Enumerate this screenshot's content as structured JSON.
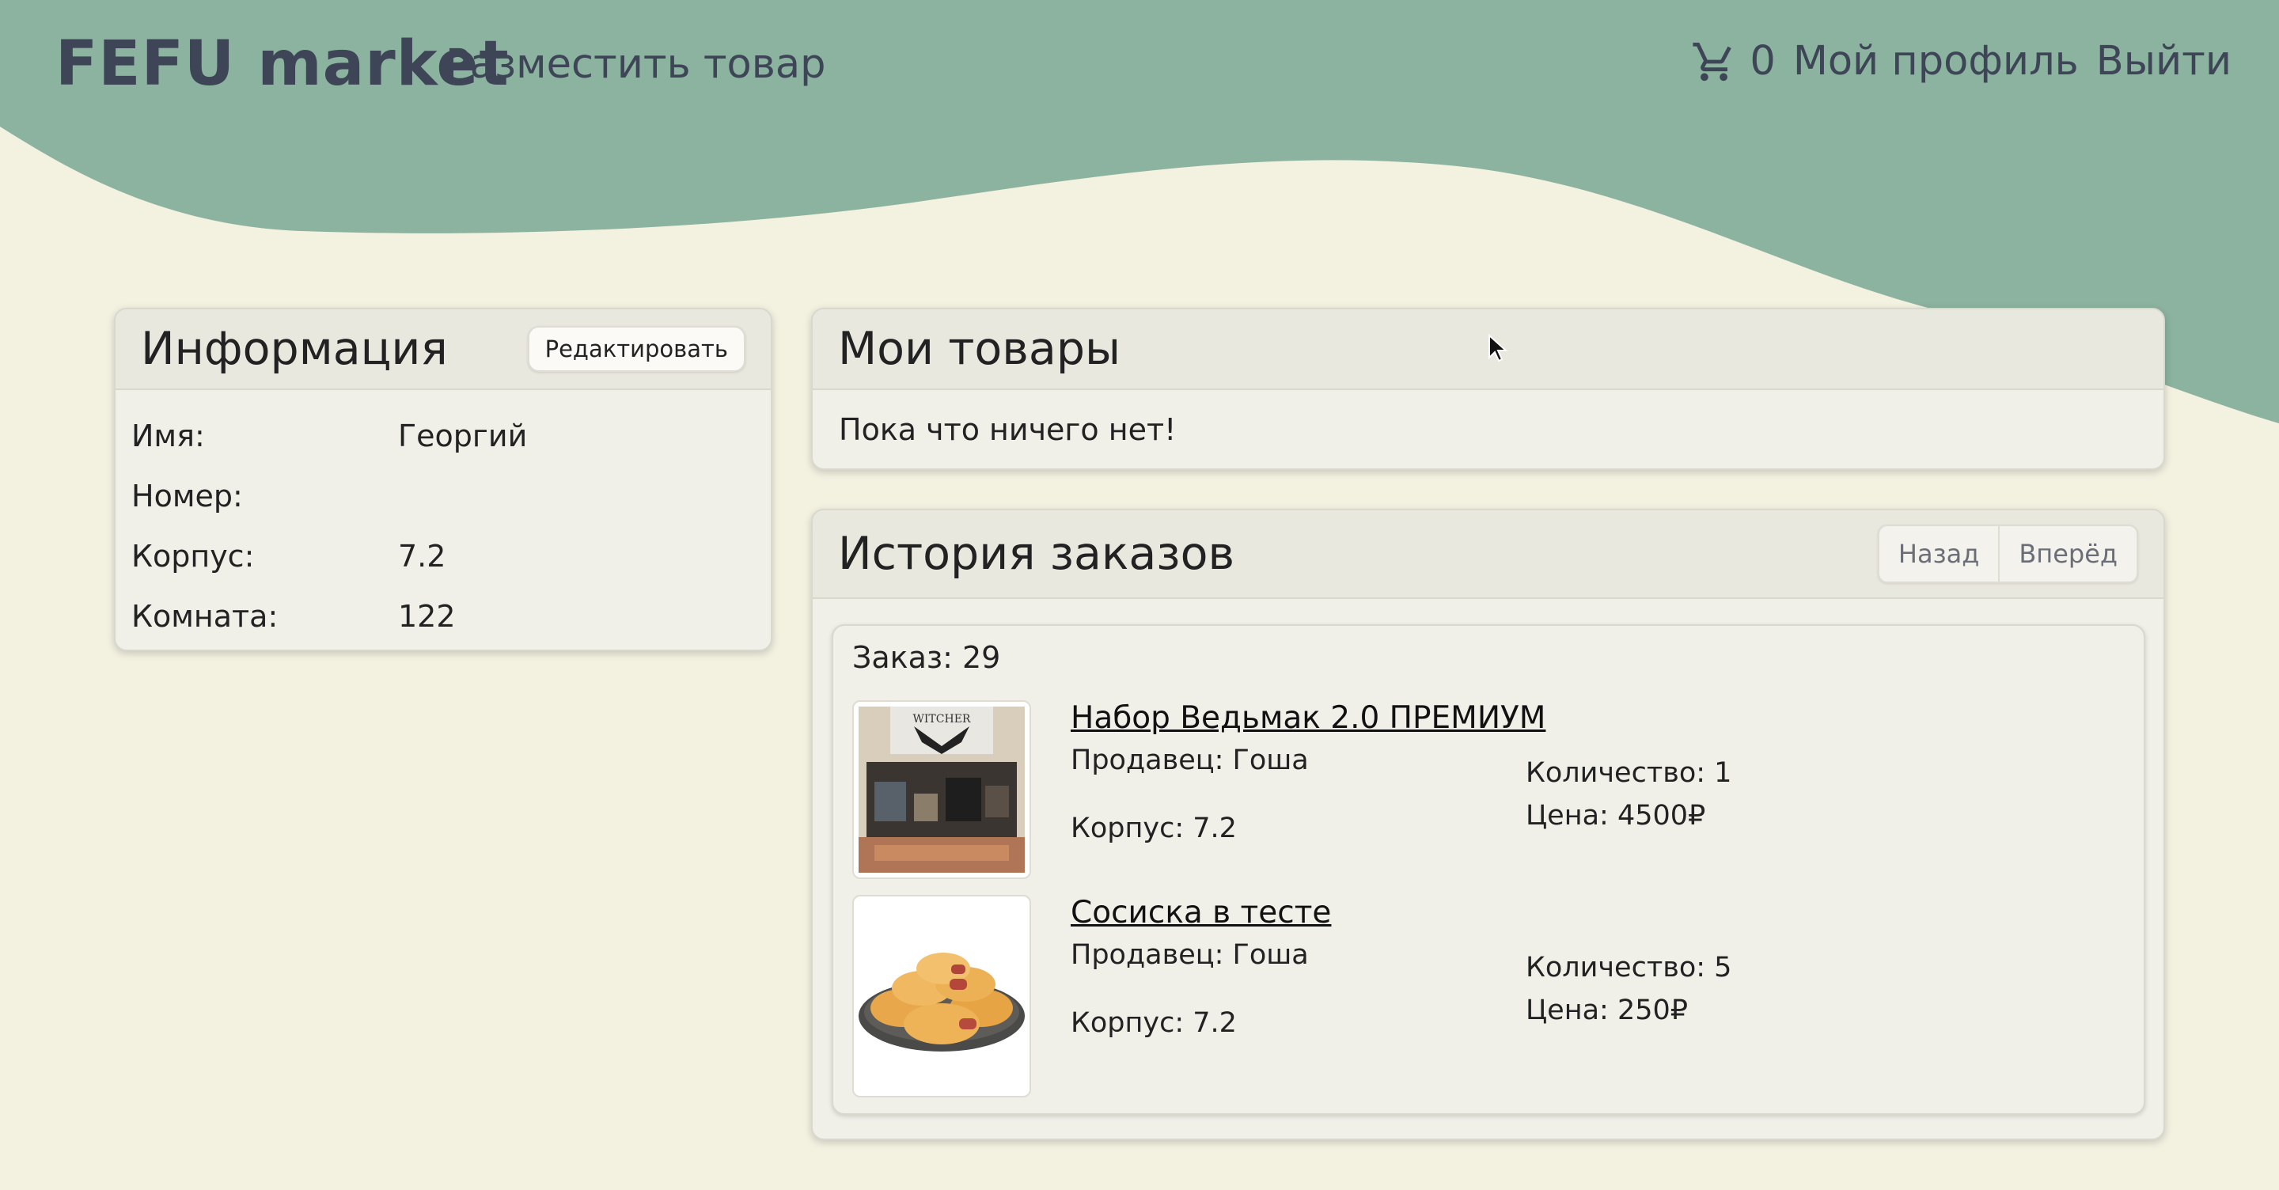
{
  "header": {
    "brand": "FEFU market",
    "post_item": "Разместить товар",
    "cart_count": "0",
    "profile": "Мой профиль",
    "logout": "Выйти"
  },
  "info": {
    "title": "Информация",
    "edit_label": "Редактировать",
    "rows": [
      {
        "label": "Имя:",
        "value": "Георгий"
      },
      {
        "label": "Номер:",
        "value": ""
      },
      {
        "label": "Корпус:",
        "value": "7.2"
      },
      {
        "label": "Комната:",
        "value": "122"
      }
    ]
  },
  "products": {
    "title": "Мои товары",
    "empty": "Пока что ничего нет!"
  },
  "history": {
    "title": "История заказов",
    "prev": "Назад",
    "next": "Вперёд",
    "order_title": "Заказ: 29",
    "items": [
      {
        "name": "Набор Ведьмак 2.0 ПРЕМИУМ",
        "seller": "Продавец: Гоша",
        "building": "Корпус: 7.2",
        "quantity": "Количество: 1",
        "price": "Цена: 4500₽",
        "image_text": "WITCHER"
      },
      {
        "name": "Сосиска в тесте",
        "seller": "Продавец: Гоша",
        "building": "Корпус: 7.2",
        "quantity": "Количество: 5",
        "price": "Цена: 250₽"
      }
    ]
  },
  "colors": {
    "background": "#f3f1e0",
    "wave": "#8cb39f",
    "text_dark": "#3d4556"
  }
}
